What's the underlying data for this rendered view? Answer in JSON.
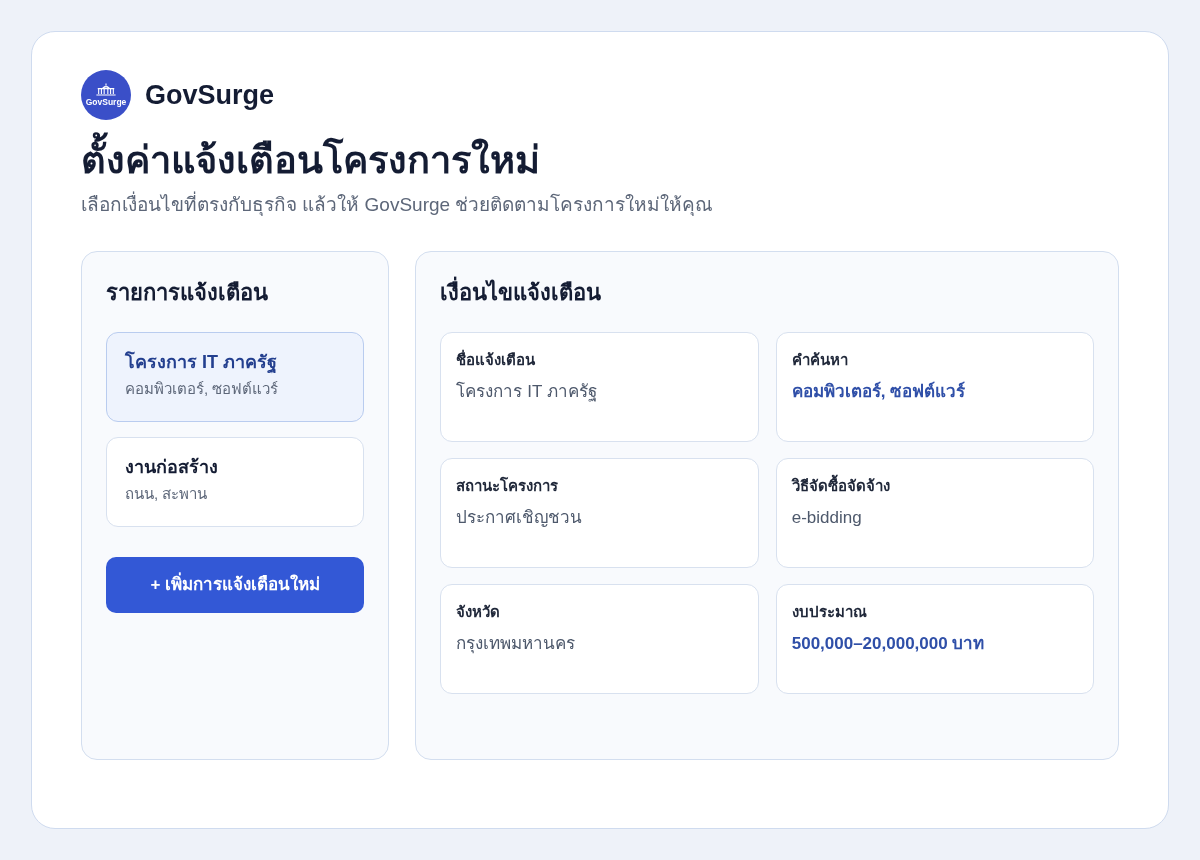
{
  "brand": {
    "logo_text": "GovSurge",
    "name": "GovSurge"
  },
  "page": {
    "title": "ตั้งค่าแจ้งเตือนโครงการใหม่",
    "subtitle": "เลือกเงื่อนไขที่ตรงกับธุรกิจ แล้วให้ GovSurge ช่วยติดตามโครงการใหม่ให้คุณ"
  },
  "alerts_panel": {
    "title": "รายการแจ้งเตือน",
    "items": [
      {
        "name": "โครงการ IT ภาครัฐ",
        "keywords": "คอมพิวเตอร์, ซอฟต์แวร์",
        "selected": true
      },
      {
        "name": "งานก่อสร้าง",
        "keywords": "ถนน, สะพาน",
        "selected": false
      }
    ],
    "add_button": "+ เพิ่มการแจ้งเตือนใหม่"
  },
  "conditions_panel": {
    "title": "เงื่อนไขแจ้งเตือน",
    "fields": [
      {
        "label": "ชื่อแจ้งเตือน",
        "value": "โครงการ IT ภาครัฐ",
        "highlighted": false
      },
      {
        "label": "คำค้นหา",
        "value": "คอมพิวเตอร์, ซอฟต์แวร์",
        "highlighted": true
      },
      {
        "label": "สถานะโครงการ",
        "value": "ประกาศเชิญชวน",
        "highlighted": false
      },
      {
        "label": "วิธีจัดซื้อจัดจ้าง",
        "value": "e-bidding",
        "highlighted": false
      },
      {
        "label": "จังหวัด",
        "value": "กรุงเทพมหานคร",
        "highlighted": false
      },
      {
        "label": "งบประมาณ",
        "value": "500,000–20,000,000 บาท",
        "highlighted": true
      }
    ]
  }
}
